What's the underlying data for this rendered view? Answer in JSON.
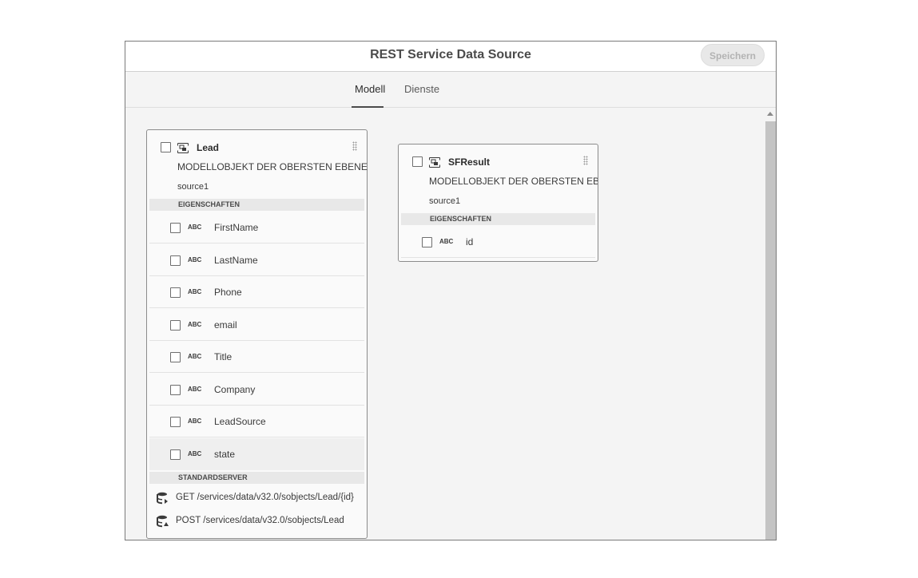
{
  "window": {
    "title": "REST Service Data Source",
    "save_label": "Speichern"
  },
  "tabs": [
    {
      "label": "Modell",
      "active": true
    },
    {
      "label": "Dienste",
      "active": false
    }
  ],
  "cards": [
    {
      "name": "Lead",
      "description": "MODELLOBJEKT DER OBERSTEN EBENE",
      "source": "source1",
      "properties_header": "EIGENSCHAFTEN",
      "properties": [
        {
          "type": "ABC",
          "name": "FirstName"
        },
        {
          "type": "ABC",
          "name": "LastName"
        },
        {
          "type": "ABC",
          "name": "Phone"
        },
        {
          "type": "ABC",
          "name": "email"
        },
        {
          "type": "ABC",
          "name": "Title"
        },
        {
          "type": "ABC",
          "name": "Company"
        },
        {
          "type": "ABC",
          "name": "LeadSource"
        },
        {
          "type": "ABC",
          "name": "state",
          "highlighted": true
        }
      ],
      "services_header": "STANDARDSERVER",
      "services": [
        {
          "icon": "database-get-icon",
          "label": "GET /services/data/v32.0/sobjects/Lead/{id}"
        },
        {
          "icon": "database-post-icon",
          "label": "POST /services/data/v32.0/sobjects/Lead"
        }
      ]
    },
    {
      "name": "SFResult",
      "description": "MODELLOBJEKT DER OBERSTEN EBENE",
      "source": "source1",
      "properties_header": "EIGENSCHAFTEN",
      "properties": [
        {
          "type": "ABC",
          "name": "id"
        }
      ]
    }
  ],
  "colors": {
    "accent": "#4b4b4b",
    "panel": "#f4f4f4",
    "section": "#e8e8e8",
    "scroll_thumb": "#c4c4c4"
  }
}
